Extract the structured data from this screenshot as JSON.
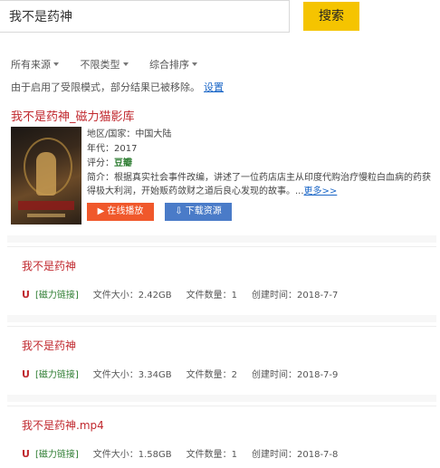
{
  "search": {
    "value": "我不是药神",
    "button": "搜索"
  },
  "filters": [
    "所有来源",
    "不限类型",
    "综合排序"
  ],
  "notice": {
    "text": "由于启用了受限模式，部分结果已被移除。",
    "link": "设置"
  },
  "movie": {
    "title": "我不是药神_磁力猫影库",
    "region": "地区/国家：中国大陆",
    "year": "年代：2017",
    "rating_label": "评分：",
    "rating_source": "豆瓣",
    "intro": "简介：根据真实社会事件改编，讲述了一位药店店主从印度代购治疗慢粒白血病的药获得极大利润，开始贩药敛财之道后良心发现的故事。...",
    "more": "更多>>",
    "play_label": "▶ 在线播放",
    "download_label": "⇩ 下载资源"
  },
  "results": [
    {
      "title": "我不是药神",
      "magnet": "[磁力链接]",
      "size": "文件大小：2.42GB",
      "count": "文件数量：1",
      "created": "创建时间：2018-7-7"
    },
    {
      "title": "我不是药神",
      "magnet": "[磁力链接]",
      "size": "文件大小：3.34GB",
      "count": "文件数量：2",
      "created": "创建时间：2018-7-9"
    },
    {
      "title": "我不是药神.mp4",
      "magnet": "[磁力链接]",
      "size": "文件大小：1.58GB",
      "count": "文件数量：1",
      "created": "创建时间：2018-7-8"
    }
  ],
  "icons": {
    "magnet": "U"
  }
}
